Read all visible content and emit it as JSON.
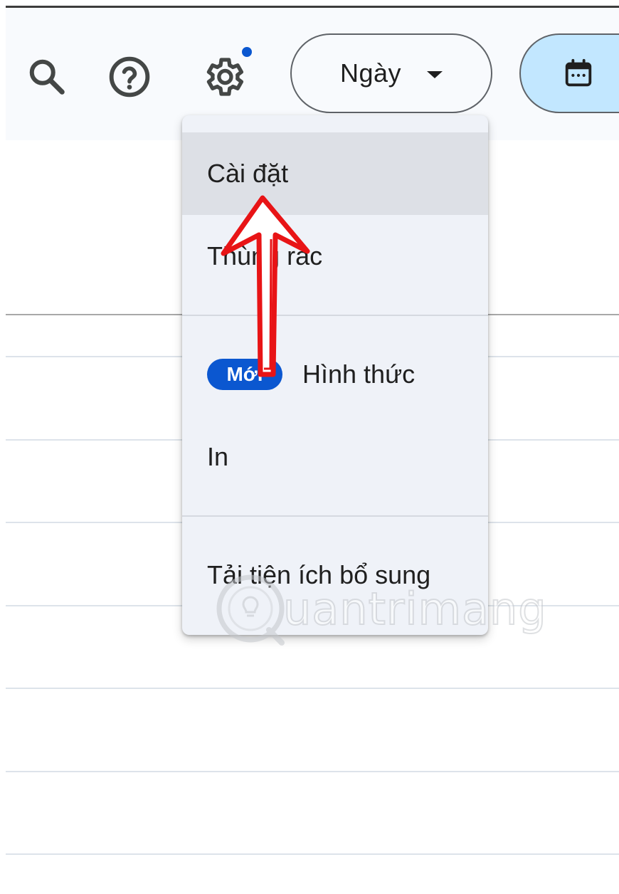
{
  "header": {
    "icons": {
      "search": "search-icon",
      "help": "help-icon",
      "settings": "gear-icon",
      "calendar": "calendar-icon"
    },
    "view_select": {
      "label": "Ngày",
      "icon": "caret-down-icon"
    },
    "notification_dot_color": "#0b57d0",
    "calendar_button_color": "#c2e7ff"
  },
  "settings_menu": {
    "items": [
      {
        "label": "Cài đặt",
        "highlighted": true
      },
      {
        "label": "Thùng rác"
      },
      {
        "label": "Hình thức",
        "badge": "Mới"
      },
      {
        "label": "In"
      },
      {
        "label": "Tải tiện ích bổ sung"
      }
    ]
  },
  "annotation": {
    "arrow_color": "#e81416",
    "target": "Cài đặt"
  },
  "watermark": {
    "text": "uantrimang",
    "logo": "quantrimang-logo"
  }
}
